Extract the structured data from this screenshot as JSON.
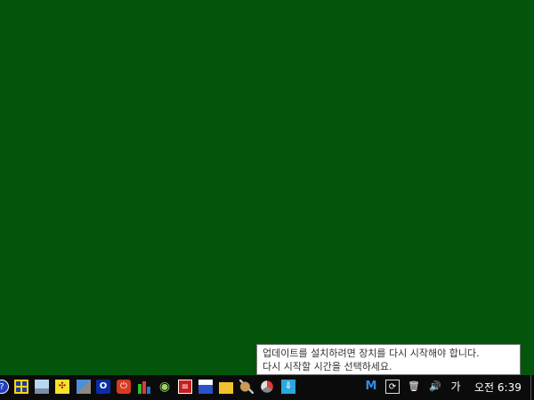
{
  "desktop": {
    "background_color": "#03550c"
  },
  "taskbar": {
    "pinned_apps": [
      {
        "name": "help-icon",
        "glyph": "?"
      },
      {
        "name": "grid-app-icon",
        "glyph": ""
      },
      {
        "name": "computer-app-icon",
        "glyph": ""
      },
      {
        "name": "yellow-app-icon",
        "glyph": "✣"
      },
      {
        "name": "network-app-icon",
        "glyph": ""
      },
      {
        "name": "blue-circle-app-icon",
        "glyph": "O"
      },
      {
        "name": "power-app-icon",
        "glyph": "⏻"
      },
      {
        "name": "chart-app-icon",
        "glyph": ""
      },
      {
        "name": "disc-app-icon",
        "glyph": "◉"
      },
      {
        "name": "red-doc-app-icon",
        "glyph": "≡"
      },
      {
        "name": "save-app-icon",
        "glyph": ""
      },
      {
        "name": "folder-icon",
        "glyph": ""
      },
      {
        "name": "paint-app-icon",
        "glyph": ""
      },
      {
        "name": "recycle-app-icon",
        "glyph": ""
      },
      {
        "name": "download-app-icon",
        "glyph": "⇩"
      }
    ]
  },
  "tray": {
    "malwarebytes_glyph": "M",
    "update_glyph": "⟳",
    "trash_glyph": "🗑",
    "volume_glyph": "🔊",
    "ime_label": "가",
    "clock": "오전 6:39"
  },
  "tooltip": {
    "line1": "업데이트를 설치하려면 장치를 다시 시작해야 합니다.",
    "line2": "다시 시작할 시간을 선택하세요."
  }
}
